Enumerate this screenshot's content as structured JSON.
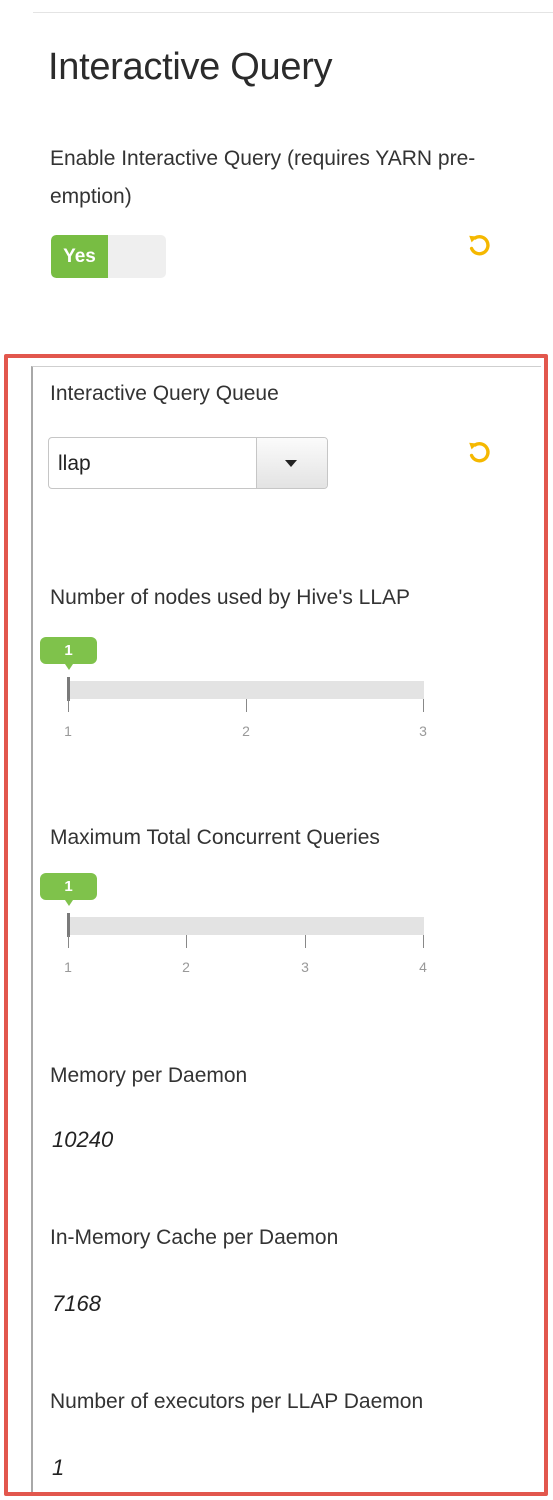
{
  "section": {
    "title": "Interactive Query",
    "enable_label": "Enable Interactive Query (requires YARN pre-emption)",
    "toggle_label": "Yes"
  },
  "queue": {
    "label": "Interactive Query Queue",
    "selected": "llap"
  },
  "nodes": {
    "label": "Number of nodes used by Hive's LLAP",
    "value": "1",
    "ticks": [
      "1",
      "2",
      "3"
    ]
  },
  "concurrent": {
    "label": "Maximum Total Concurrent Queries",
    "value": "1",
    "ticks": [
      "1",
      "2",
      "3",
      "4"
    ]
  },
  "memory": {
    "label": "Memory per Daemon",
    "value": "10240"
  },
  "cache": {
    "label": "In-Memory Cache per Daemon",
    "value": "7168"
  },
  "executors": {
    "label": "Number of executors per LLAP Daemon",
    "value": "1"
  },
  "colors": {
    "accent_green": "#78bd43",
    "undo_orange": "#f5b800",
    "highlight_border": "#e2574d"
  },
  "icons": {
    "undo": "undo-icon",
    "dropdown": "caret-down-icon"
  }
}
